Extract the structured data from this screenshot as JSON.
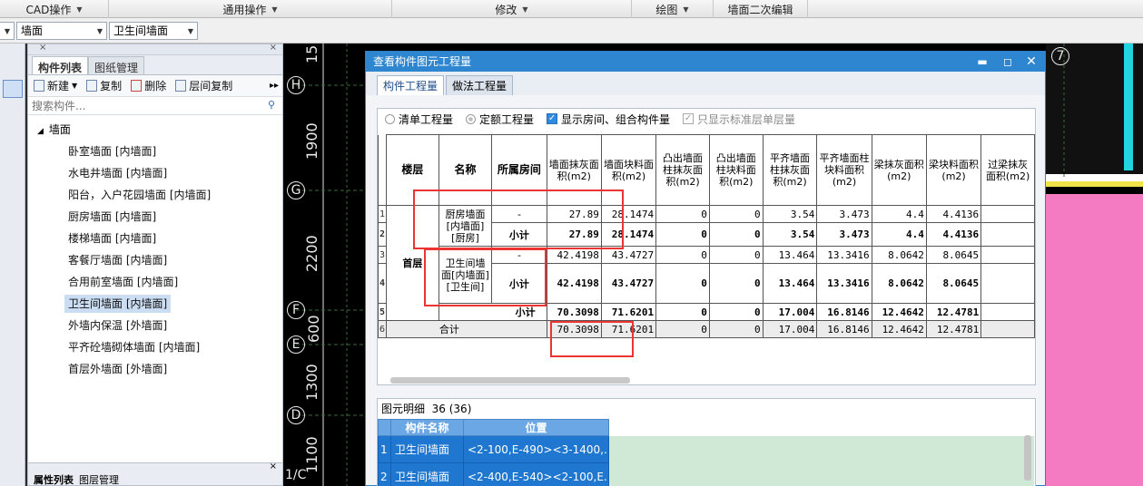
{
  "menubar": {
    "items": [
      {
        "label": "CAD操作",
        "arrow": true
      },
      {
        "label": "通用操作",
        "arrow": true
      },
      {
        "label": "修改",
        "arrow": true
      },
      {
        "label": "绘图",
        "arrow": true
      },
      {
        "label": "墙面二次编辑",
        "arrow": false
      }
    ]
  },
  "selectors": {
    "type_value": "墙面",
    "name_value": "卫生间墙面"
  },
  "left_panel": {
    "tabs": [
      "构件列表",
      "图纸管理"
    ],
    "toolbar": {
      "new": "新建",
      "copy": "复制",
      "delete": "删除",
      "floor_copy": "层间复制"
    },
    "search_placeholder": "搜索构件...",
    "tree_root": "墙面",
    "items": [
      "卧室墙面 [内墙面]",
      "水电井墙面 [内墙面]",
      "阳台，入户花园墙面 [内墙面]",
      "厨房墙面 [内墙面]",
      "楼梯墙面 [内墙面]",
      "客餐厅墙面 [内墙面]",
      "合用前室墙面 [内墙面]",
      "卫生间墙面 [内墙面]",
      "外墙内保温 [外墙面]",
      "平齐砼墙砌体墙面 [内墙面]",
      "首层外墙面 [外墙面]"
    ],
    "selected_index": 7,
    "bottom_tabs": [
      "属性列表",
      "图层管理"
    ]
  },
  "cad": {
    "axis_dims": [
      "15",
      "1900",
      "2200",
      "600",
      "1300",
      "1100"
    ],
    "axis_circles": [
      "H",
      "G",
      "F",
      "E",
      "D",
      "7"
    ],
    "axis_label_bottom": "1/C"
  },
  "dialog": {
    "title": "查看构件图元工程量",
    "tabs": [
      "构件工程量",
      "做法工程量"
    ],
    "options": {
      "list_qty": "清单工程量",
      "quota_qty": "定额工程量",
      "show_room": "显示房间、组合构件量",
      "only_std": "只显示标准层单层量"
    },
    "table": {
      "headers": [
        "楼层",
        "名称",
        "所属房间",
        "墙面抹灰面积(m2)",
        "墙面块料面积(m2)",
        "凸出墙面柱抹灰面积(m2)",
        "凸出墙面柱块料面积(m2)",
        "平齐墙面柱抹灰面积(m2)",
        "平齐墙面柱块料面积(m2)",
        "梁抹灰面积(m2)",
        "梁块料面积(m2)",
        "过梁抹灰面积(m2)"
      ],
      "floor": "首层",
      "comp1": "厨房墙面[内墙面][厨房]",
      "comp2": "卫生间墙面[内墙面][卫生间]",
      "dash": "-",
      "subtotal": "小计",
      "total": "合计",
      "rows": {
        "r1": [
          "27.89",
          "28.1474",
          "0",
          "0",
          "3.54",
          "3.473",
          "4.4",
          "4.4136"
        ],
        "r2": [
          "27.89",
          "28.1474",
          "0",
          "0",
          "3.54",
          "3.473",
          "4.4",
          "4.4136"
        ],
        "r3": [
          "42.4198",
          "43.4727",
          "0",
          "0",
          "13.464",
          "13.3416",
          "8.0642",
          "8.0645"
        ],
        "r4": [
          "42.4198",
          "43.4727",
          "0",
          "0",
          "13.464",
          "13.3416",
          "8.0642",
          "8.0645"
        ],
        "r5": [
          "70.3098",
          "71.6201",
          "0",
          "0",
          "17.004",
          "16.8146",
          "12.4642",
          "12.4781"
        ],
        "r6": [
          "70.3098",
          "71.6201",
          "0",
          "0",
          "17.004",
          "16.8146",
          "12.4642",
          "12.4781"
        ]
      },
      "row_numbers": [
        "1",
        "2",
        "3",
        "4",
        "5",
        "6"
      ]
    },
    "detail": {
      "title": "图元明细",
      "count": "36 (36)",
      "headers": [
        "构件名称",
        "位置"
      ],
      "rows": [
        {
          "n": "1",
          "name": "卫生间墙面",
          "pos": "<2-100,E-490><3-1400,..."
        },
        {
          "n": "2",
          "name": "卫生间墙面",
          "pos": "<2-400,E-540><2-100,E..."
        }
      ]
    }
  },
  "colors": {
    "title_blue": "#2f86d0",
    "annotation_red": "#e33333",
    "selection": "#1f77d0",
    "pink": "#f47bc2",
    "cyan": "#22d3e0"
  }
}
